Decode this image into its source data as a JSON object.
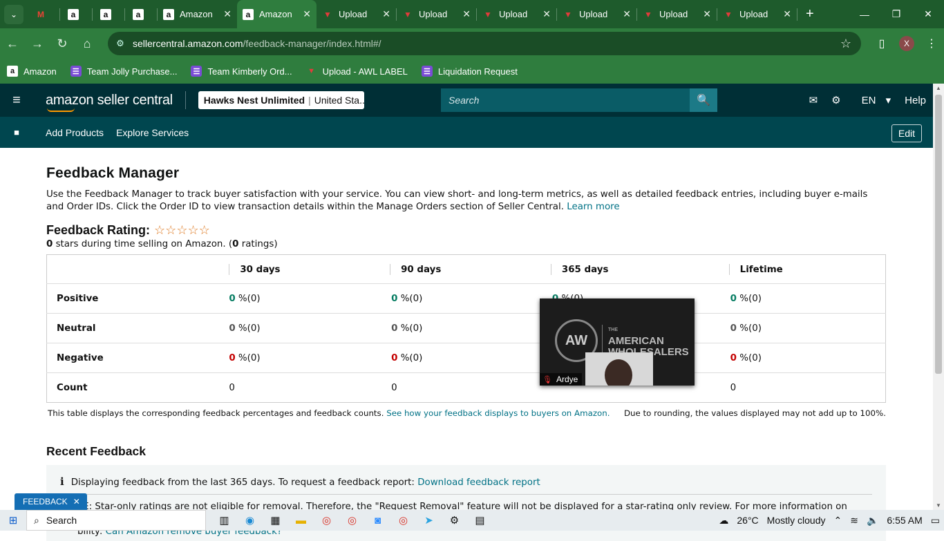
{
  "browser": {
    "tabs": [
      {
        "type": "small",
        "icon": "gmail-icon",
        "glyph": "M",
        "title": "",
        "active": false
      },
      {
        "type": "small",
        "icon": "amazon-icon",
        "glyph": "a",
        "title": "",
        "active": false
      },
      {
        "type": "small",
        "icon": "amazon-icon",
        "glyph": "a",
        "title": "",
        "active": false
      },
      {
        "type": "small",
        "icon": "amazon-icon",
        "glyph": "a",
        "title": "",
        "active": false
      },
      {
        "type": "mid",
        "icon": "amazon-icon",
        "glyph": "a",
        "title": "Amazon",
        "active": false
      },
      {
        "type": "mid",
        "icon": "amazon-icon",
        "glyph": "a",
        "title": "Amazon",
        "active": true
      },
      {
        "type": "mid",
        "icon": "upload-icon",
        "glyph": "▼",
        "title": "Upload",
        "active": false
      },
      {
        "type": "mid",
        "icon": "upload-icon",
        "glyph": "▼",
        "title": "Upload",
        "active": false
      },
      {
        "type": "mid",
        "icon": "upload-icon",
        "glyph": "▼",
        "title": "Upload",
        "active": false
      },
      {
        "type": "mid",
        "icon": "upload-icon",
        "glyph": "▼",
        "title": "Upload",
        "active": false
      },
      {
        "type": "mid",
        "icon": "upload-icon",
        "glyph": "▼",
        "title": "Upload",
        "active": false
      },
      {
        "type": "mid",
        "icon": "upload-icon",
        "glyph": "▼",
        "title": "Upload",
        "active": false
      }
    ],
    "url_host": "sellercentral.amazon.com",
    "url_path": "/feedback-manager/index.html#/",
    "profile_initial": "X",
    "bookmarks": [
      {
        "icon": "amazon-icon",
        "kind": "amz",
        "label": "Amazon"
      },
      {
        "icon": "list-icon",
        "kind": "list",
        "label": "Team Jolly Purchase..."
      },
      {
        "icon": "list-icon",
        "kind": "list",
        "label": "Team Kimberly Ord..."
      },
      {
        "icon": "upload-icon",
        "kind": "up",
        "label": "Upload - AWL LABEL"
      },
      {
        "icon": "list-icon",
        "kind": "list",
        "label": "Liquidation Request"
      }
    ]
  },
  "seller": {
    "logo_text": "amazon seller central",
    "store_name": "Hawks Nest Unlimited",
    "store_region": "United Sta...",
    "search_placeholder": "Search",
    "language": "EN",
    "help": "Help",
    "nav": {
      "add_products": "Add Products",
      "explore_services": "Explore Services",
      "edit": "Edit"
    }
  },
  "page": {
    "title": "Feedback Manager",
    "description": "Use the Feedback Manager to track buyer satisfaction with your service. You can view short- and long-term metrics, as well as detailed feedback entries, including buyer e-mails and Order IDs. Click the Order ID to view transaction details within the Manage Orders section of Seller Central.",
    "learn_more": "Learn more",
    "rating_label": "Feedback Rating:",
    "stars_filled": 0,
    "stars_total": 5,
    "stars_value": "0",
    "stars_text_mid": " stars during time selling on Amazon. (",
    "ratings_count": "0",
    "stars_text_end": " ratings)",
    "table": {
      "columns": [
        "",
        "30 days",
        "90 days",
        "365 days",
        "Lifetime"
      ],
      "rows": [
        {
          "label": "Positive",
          "cls": "green",
          "cells": [
            [
              "0",
              " %(0)"
            ],
            [
              "0",
              " %(0)"
            ],
            [
              "0",
              " %(0)"
            ],
            [
              "0",
              " %(0)"
            ]
          ]
        },
        {
          "label": "Neutral",
          "cls": "gray",
          "cells": [
            [
              "0",
              " %(0)"
            ],
            [
              "0",
              " %(0)"
            ],
            [
              "",
              ""
            ],
            [
              "0",
              " %(0)"
            ]
          ]
        },
        {
          "label": "Negative",
          "cls": "red",
          "cells": [
            [
              "0",
              " %(0)"
            ],
            [
              "0",
              " %(0)"
            ],
            [
              "",
              ""
            ],
            [
              "0",
              " %(0)"
            ]
          ]
        },
        {
          "label": "Count",
          "cls": "",
          "cells": [
            [
              "",
              "0"
            ],
            [
              "",
              "0"
            ],
            [
              "",
              ""
            ],
            [
              "",
              "0"
            ]
          ]
        }
      ]
    },
    "table_note": "This table displays the corresponding feedback percentages and feedback counts.",
    "table_note_link": "See how your feedback displays to buyers on Amazon.",
    "rounding_note": "Due to rounding, the values displayed may not add up to 100%.",
    "recent_title": "Recent Feedback",
    "info_text": "Displaying feedback from the last 365 days. To request a feedback report:",
    "info_link": "Download feedback report",
    "note_text": "TE: Star-only ratings are not eligible for removal. Therefore, the \"Request Removal\" feature will not be displayed for a star-rating only review. For more information on removal",
    "note_text2": "bility:",
    "note_link": "Can Amazon remove buyer feedback?"
  },
  "video": {
    "name": "Ardye",
    "brand_line1": "THE",
    "brand_line2": "AMERICAN",
    "brand_line3": "WHOLESALERS",
    "logo": "AW"
  },
  "feedback_button": "FEEDBACK",
  "taskbar": {
    "search": "Search",
    "temperature": "26°C",
    "weather": "Mostly cloudy",
    "time": "6:55 AM"
  }
}
